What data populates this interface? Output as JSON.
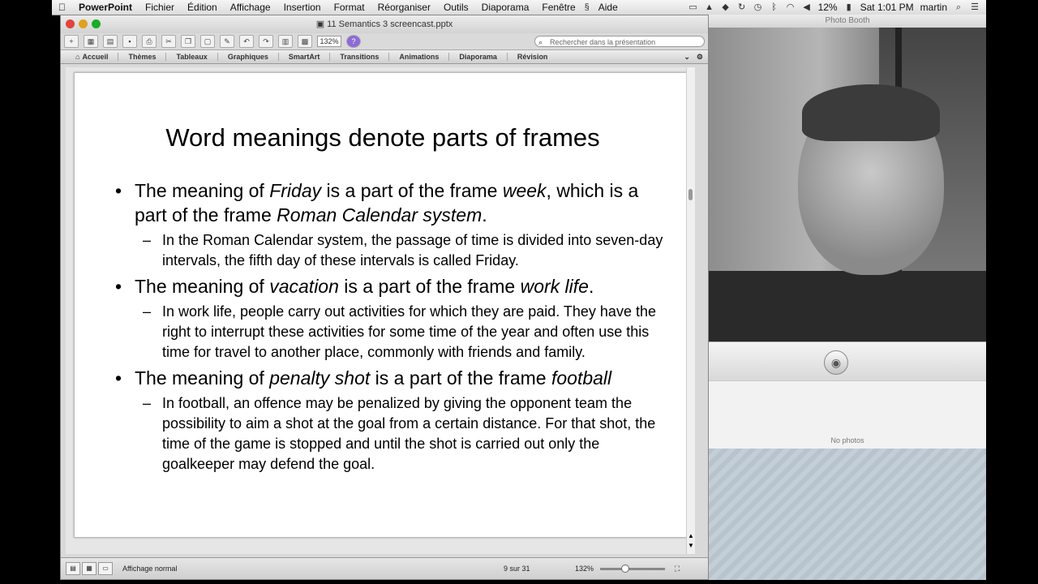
{
  "menubar": {
    "app": "PowerPoint",
    "items": [
      "Fichier",
      "Édition",
      "Affichage",
      "Insertion",
      "Format",
      "Réorganiser",
      "Outils",
      "Diaporama",
      "Fenêtre"
    ],
    "help": "Aide",
    "battery": "12%",
    "clock": "Sat 1:01 PM",
    "user": "martin"
  },
  "ppt": {
    "window_title": "11 Semantics 3 screencast.pptx",
    "zoom": "132%",
    "search_placeholder": "Rechercher dans la présentation",
    "ribbon": [
      "Accueil",
      "Thèmes",
      "Tableaux",
      "Graphiques",
      "SmartArt",
      "Transitions",
      "Animations",
      "Diaporama",
      "Révision"
    ],
    "slide": {
      "title": "Word meanings denote parts of frames",
      "bullets": [
        {
          "parts": [
            "The meaning of ",
            "Friday",
            " is a part of the frame ",
            "week",
            ", which is a part of the frame ",
            "Roman Calendar system",
            "."
          ],
          "sub": "In the Roman Calendar system, the passage of time is divided into seven-day intervals, the fifth day of these intervals is called Friday."
        },
        {
          "parts": [
            "The meaning of ",
            "vacation",
            " is a part of the frame ",
            "work life",
            "."
          ],
          "sub": "In work life, people carry out activities for which they are paid. They have the right to interrupt these activities for some time of the year and often use this time for travel to another place, commonly with friends and family."
        },
        {
          "parts": [
            "The meaning of ",
            "penalty shot",
            " is a part of the frame ",
            "football"
          ],
          "sub": "In football, an offence may be penalized by giving the opponent team the possibility to aim a shot at the goal from a certain distance. For that shot, the time of the game is stopped and until the shot is carried out only the goalkeeper may defend the goal."
        }
      ]
    },
    "status": {
      "view": "Affichage normal",
      "page": "9 sur 31",
      "zoom": "132%"
    }
  },
  "booth": {
    "title": "Photo Booth",
    "empty_label": "No photos"
  }
}
